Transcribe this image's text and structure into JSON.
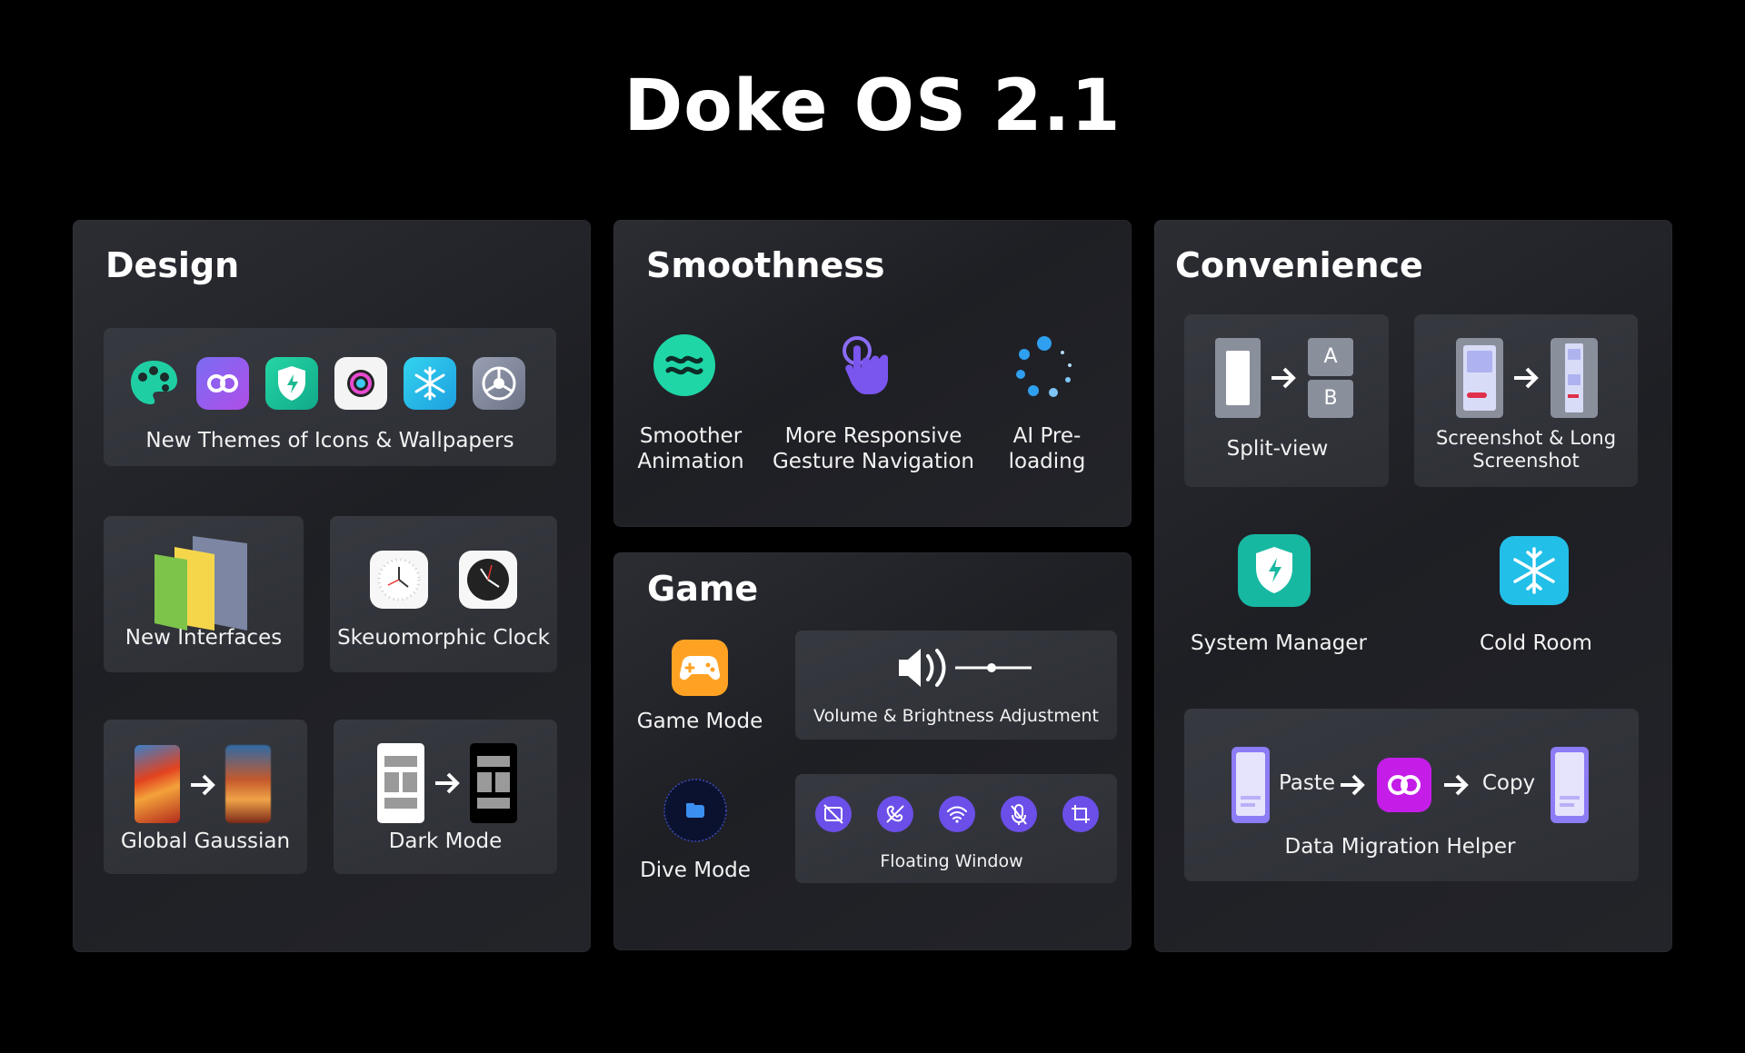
{
  "title": "Doke OS 2.1",
  "design": {
    "title": "Design",
    "themes_label": "New Themes of Icons & Wallpapers",
    "interfaces_label": "New Interfaces",
    "clock_label": "Skeuomorphic Clock",
    "gaussian_label": "Global Gaussian",
    "dark_label": "Dark Mode"
  },
  "smoothness": {
    "title": "Smoothness",
    "items": [
      {
        "label": "Smoother Animation",
        "icon": "waves-icon"
      },
      {
        "label": "More Responsive Gesture Navigation",
        "icon": "tap-hand-icon"
      },
      {
        "label": "AI Pre-loading",
        "icon": "loading-dots-icon"
      }
    ]
  },
  "game": {
    "title": "Game",
    "game_mode": "Game Mode",
    "dive_mode": "Dive Mode",
    "volume_label": "Volume & Brightness Adjustment",
    "floating_label": "Floating Window"
  },
  "convenience": {
    "title": "Convenience",
    "split_view": "Split-view",
    "split_a": "A",
    "split_b": "B",
    "screenshot": "Screenshot & Long Screenshot",
    "system_manager": "System Manager",
    "cold_room": "Cold Room",
    "paste": "Paste",
    "copy": "Copy",
    "migration": "Data Migration Helper"
  },
  "colors": {
    "background": "#000000",
    "panel": "#25272c",
    "card": "#33353b",
    "accent_teal": "#1fc9a6",
    "accent_purple": "#7a5cf0",
    "accent_blue": "#2f9ff0",
    "accent_orange": "#ff9a1f",
    "accent_magenta": "#c21ee6"
  }
}
